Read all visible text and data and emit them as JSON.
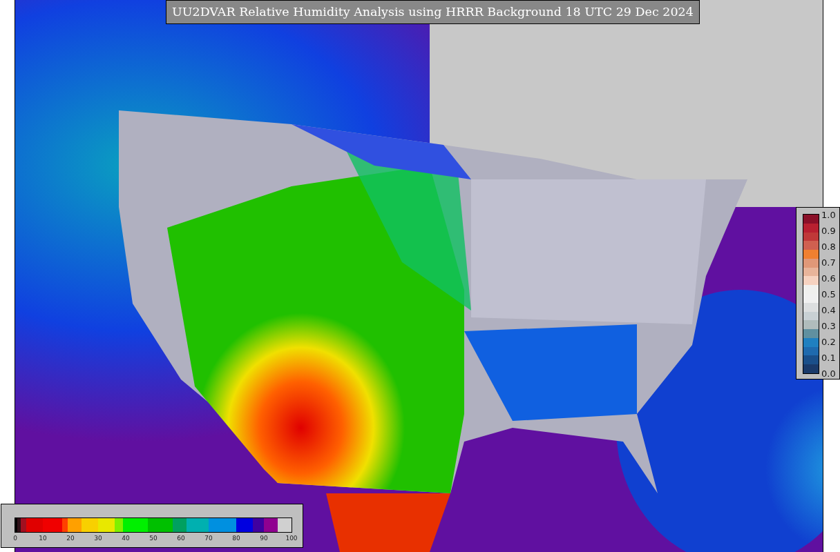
{
  "title": "UU2DVAR Relative Humidity Analysis using HRRR Background 18 UTC 29 Dec 2024",
  "humidity_colorbar": {
    "ticks": [
      "0",
      "10",
      "20",
      "30",
      "40",
      "50",
      "60",
      "70",
      "80",
      "90",
      "100"
    ]
  },
  "station_colorbar": {
    "ticks": [
      "1.0",
      "0.9",
      "0.8",
      "0.7",
      "0.6",
      "0.5",
      "0.4",
      "0.3",
      "0.2",
      "0.1",
      "0.0"
    ]
  }
}
